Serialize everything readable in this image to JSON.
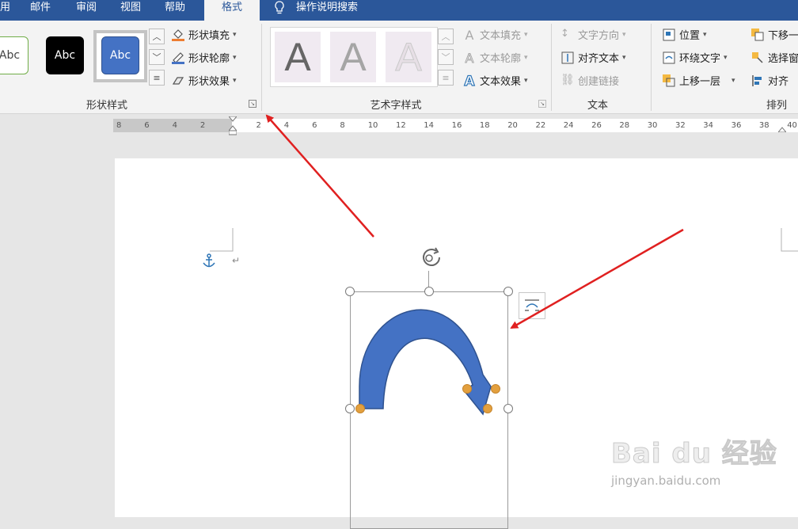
{
  "tabs": [
    {
      "label": "用"
    },
    {
      "label": "邮件"
    },
    {
      "label": "审阅"
    },
    {
      "label": "视图"
    },
    {
      "label": "帮助"
    },
    {
      "label": "格式",
      "active": true
    },
    {
      "label": "操作说明搜索"
    }
  ],
  "shape_styles": {
    "swatches": [
      {
        "label": "Abc",
        "style": "outline-green"
      },
      {
        "label": "Abc",
        "style": "black"
      },
      {
        "label": "Abc",
        "style": "blue-selected"
      }
    ],
    "fill_label": "形状填充",
    "outline_label": "形状轮廓",
    "effect_label": "形状效果",
    "group_label": "形状样式"
  },
  "wordart": {
    "letters": [
      "A",
      "A",
      "A"
    ],
    "text_fill_label": "文本填充",
    "text_outline_label": "文本轮廓",
    "text_effect_label": "文本效果",
    "group_label": "艺术字样式"
  },
  "text_group": {
    "direction_label": "文字方向",
    "align_label": "对齐文本",
    "link_label": "创建链接",
    "group_label": "文本"
  },
  "arrange": {
    "position_label": "位置",
    "wrap_label": "环绕文字",
    "forward_label": "上移一层",
    "backward_label": "下移一",
    "select_label": "选择窗",
    "align_label": "对齐",
    "group_label": "排列"
  },
  "ruler": {
    "ticks": [
      "8",
      "6",
      "4",
      "2",
      "",
      "2",
      "4",
      "6",
      "8",
      "10",
      "12",
      "14",
      "16",
      "18",
      "20",
      "22",
      "24",
      "26",
      "28",
      "30",
      "32",
      "34",
      "36",
      "38",
      "40"
    ]
  },
  "watermark": {
    "brand": "Bai du 经验",
    "url": "jingyan.baidu.com"
  },
  "colors": {
    "accent": "#2b579a",
    "shape_fill": "#4472c4",
    "annotation_arrow": "#e02020",
    "adjust_handle": "#e3a03e"
  }
}
